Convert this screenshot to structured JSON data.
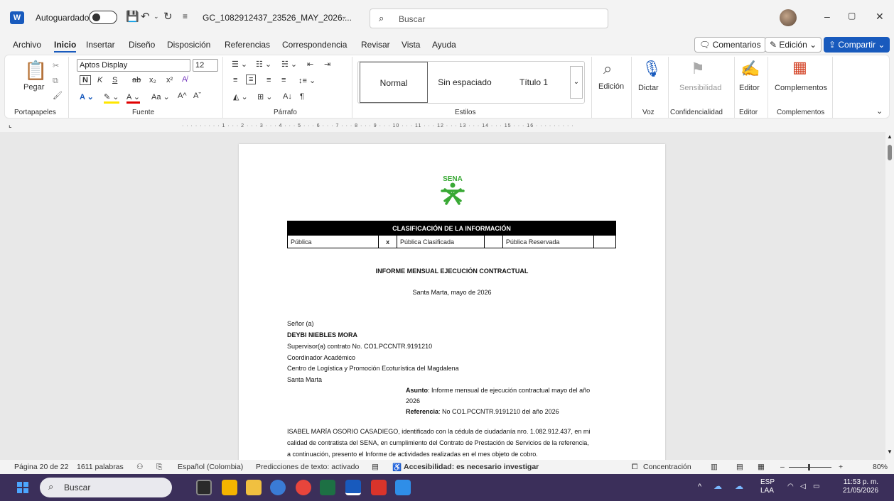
{
  "titlebar": {
    "app_icon": "word-icon",
    "autosave_label": "Autoguardado",
    "document_title": "GC_1082912437_23526_MAY_2026....",
    "search_placeholder": "Buscar",
    "minimize": "–",
    "restore": "▢",
    "close": "✕"
  },
  "menu": {
    "items": [
      "Archivo",
      "Inicio",
      "Insertar",
      "Diseño",
      "Disposición",
      "Referencias",
      "Correspondencia",
      "Revisar",
      "Vista",
      "Ayuda"
    ],
    "active": "Inicio",
    "comments": "Comentarios",
    "editing": "Edición",
    "share": "Compartir"
  },
  "ribbon": {
    "paste_label": "Pegar",
    "font_name": "Aptos Display",
    "font_size": "12",
    "styles": [
      "Normal",
      "Sin espaciado",
      "Título 1"
    ],
    "editing_label": "Edición",
    "dictate_label": "Dictar",
    "sensitivity_label": "Sensibilidad",
    "editor_label": "Editor",
    "addins_label": "Complementos",
    "groups": {
      "clipboard": "Portapapeles",
      "font": "Fuente",
      "paragraph": "Párrafo",
      "styles": "Estilos",
      "voice": "Voz",
      "confidentiality": "Confidencialidad",
      "editor": "Editor",
      "addins": "Complementos"
    }
  },
  "ruler_text": "· · · · · · ·  · · 1 · · · 2 · · · 3 · · · 4 · · · 5 · · · 6 · · · 7 · · · 8 · · · 9 · · · 10 · · · 11 · · · 12 · · · 13 · · · 14 · · · 15 · · · 16 · · · · · · · · ·",
  "document": {
    "logo_text": "SENA",
    "classification": {
      "header": "CLASIFICACIÓN DE LA INFORMACIÓN",
      "publica": "Pública",
      "mark": "x",
      "clasificada": "Pública Clasificada",
      "reservada": "Pública Reservada"
    },
    "report_title": "INFORME MENSUAL EJECUCIÓN CONTRACTUAL",
    "place_date": "Santa Marta, mayo de 2026",
    "salutation": "Señor (a)",
    "recipient_name": "DEYBI NIEBLES MORA",
    "recipient_contract": "Supervisor(a) contrato No. CO1.PCCNTR.9191210",
    "recipient_role": "Coordinador Académico",
    "recipient_center": "Centro de Logística y Promoción Ecoturística del Magdalena",
    "recipient_city": "Santa Marta",
    "subject_label": "Asunto",
    "subject_text": ": Informe mensual de ejecución contractual mayo del año",
    "subject_year": "2026",
    "reference_label": "Referencia",
    "reference_text": ": No CO1.PCCNTR.9191210 del año 2026",
    "body_line1": "ISABEL MARÍA OSORIO CASADIEGO, identificado con la cédula de ciudadanía nro. 1.082.912.437, en mi",
    "body_line2": "calidad de contratista del SENA, en cumplimiento del Contrato de Prestación de Servicios de la referencia,",
    "body_line3": "a continuación, presento el Informe de actividades realizadas en el mes objeto de cobro."
  },
  "statusbar": {
    "page": "Página 20 de 22",
    "words": "1611 palabras",
    "language": "Español (Colombia)",
    "predictions": "Predicciones de texto: activado",
    "accessibility": "Accesibilidad: es necesario investigar",
    "focus": "Concentración",
    "zoom_minus": "–",
    "zoom_plus": "+",
    "zoom": "80%"
  },
  "taskbar": {
    "search": "Buscar",
    "lang_line1": "ESP",
    "lang_line2": "LAA",
    "time": "11:53 p. m.",
    "date": "21/05/2026"
  },
  "colors": {
    "accent": "#185abd",
    "sena_green": "#39a935",
    "taskbar": "#3b2f5a"
  }
}
